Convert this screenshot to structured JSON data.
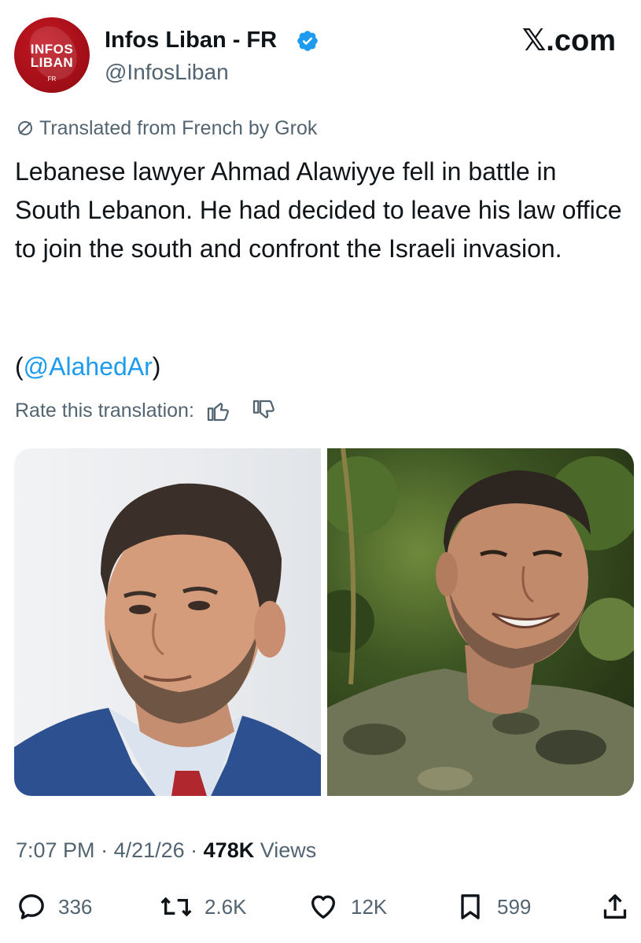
{
  "header": {
    "avatar_lines": [
      "INFOS",
      "LIBAN",
      "FR"
    ],
    "display_name": "Infos Liban - FR",
    "handle": "@InfosLiban",
    "brand": "𝕏.com",
    "verified_color": "#1d9bf0"
  },
  "tweet": {
    "translated_note": "Translated from French by Grok",
    "body": "Lebanese lawyer Ahmad Alawiyye fell in battle in South Lebanon. He had decided to leave his law office to join the south and confront the Israeli invasion.",
    "mention_open": "(",
    "mention": "@AlahedAr",
    "mention_close": ")",
    "rate_label": "Rate this translation:"
  },
  "media": {
    "photos": [
      "portrait-in-suit",
      "portrait-in-camouflage"
    ]
  },
  "meta": {
    "time": "7:07 PM",
    "sep1": " · ",
    "date": "4/21/26",
    "sep2": " · ",
    "views_count": "478K",
    "views_label": " Views"
  },
  "actions": {
    "replies": "336",
    "reposts": "2.6K",
    "likes": "12K",
    "bookmarks": "599"
  },
  "colors": {
    "accent": "#1d9bf0",
    "muted": "#536471",
    "text": "#0f1419",
    "avatar_red": "#a50f18"
  }
}
